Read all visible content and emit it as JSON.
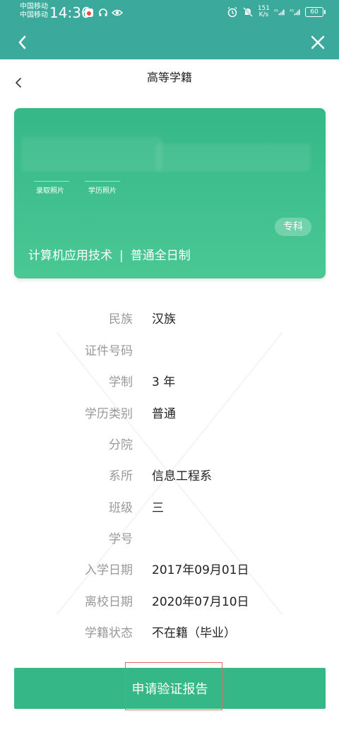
{
  "status_bar": {
    "carrier_1": "中国移动",
    "carrier_2": "中国移动",
    "time": "14:36",
    "speed_value": "151",
    "speed_unit": "K/s",
    "battery": "60"
  },
  "nav": {
    "title": "高等学籍"
  },
  "card": {
    "photo_label_1": "录取照片",
    "photo_label_2": "学历照片",
    "level": "专科",
    "major": "计算机应用技术",
    "separator": "|",
    "study_mode": "普通全日制",
    "accent_color": "#35b788"
  },
  "info": [
    {
      "label": "民族",
      "value": "汉族"
    },
    {
      "label": "证件号码",
      "value": ""
    },
    {
      "label": "学制",
      "value": "3 年"
    },
    {
      "label": "学历类别",
      "value": "普通"
    },
    {
      "label": "分院",
      "value": ""
    },
    {
      "label": "系所",
      "value": "信息工程系"
    },
    {
      "label": "班级",
      "value": "三"
    },
    {
      "label": "学号",
      "value": ""
    },
    {
      "label": "入学日期",
      "value": "2017年09月01日"
    },
    {
      "label": "离校日期",
      "value": "2020年07月10日"
    },
    {
      "label": "学籍状态",
      "value": "不在籍（毕业）"
    }
  ],
  "apply_button": {
    "label": "申请验证报告"
  }
}
